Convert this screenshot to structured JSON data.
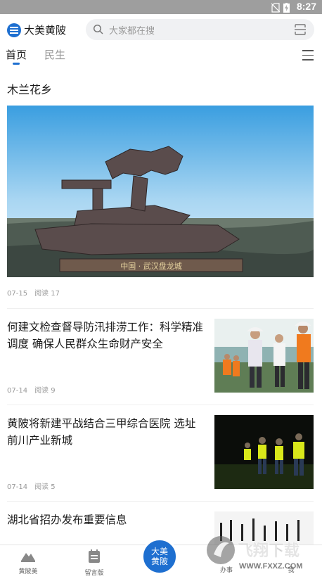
{
  "status_bar": {
    "time": "8:27"
  },
  "header": {
    "logo_text": "大美黄陂",
    "search_placeholder": "大家都在搜"
  },
  "tabs": [
    {
      "label": "首页"
    },
    {
      "label": "民生"
    }
  ],
  "feature": {
    "title": "木兰花乡",
    "date": "07-15",
    "reads": "阅读 17",
    "image_caption": "中国 · 武汉盘龙城"
  },
  "news": [
    {
      "title": "何建文检查督导防汛排涝工作：科学精准调度 确保人民群众生命财产安全",
      "date": "07-14",
      "reads": "阅读 9"
    },
    {
      "title": "黄陂将新建平战结合三甲综合医院 选址前川产业新城",
      "date": "07-14",
      "reads": "阅读 5"
    },
    {
      "title": "湖北省招办发布重要信息"
    }
  ],
  "bottom_nav": [
    {
      "label": "黄陂美"
    },
    {
      "label": "留言版"
    },
    {
      "label": "大美黄陂"
    },
    {
      "label": "办事"
    },
    {
      "label": "我"
    }
  ],
  "watermark": {
    "text": "飞翔下载",
    "url": "WWW.FXXZ.COM"
  },
  "colors": {
    "accent": "#1e6fd0",
    "statusbar": "#9e9e9e"
  }
}
